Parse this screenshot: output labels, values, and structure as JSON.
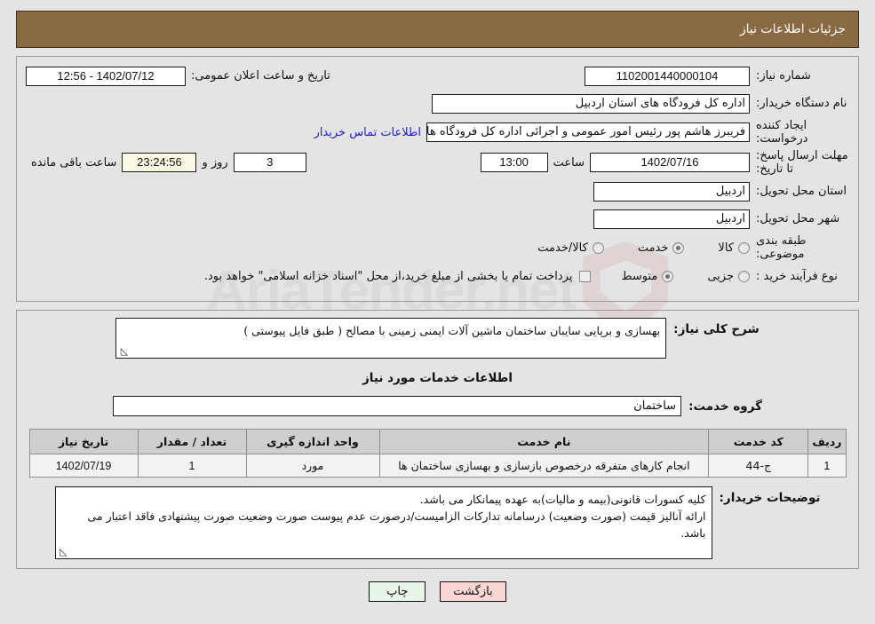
{
  "header": {
    "title": "جزئیات اطلاعات نیاز"
  },
  "form": {
    "need_number_label": "شماره نیاز:",
    "need_number_value": "1102001440000104",
    "public_announce_label": "تاریخ و ساعت اعلان عمومی:",
    "public_announce_value": "12:56 - 1402/07/12",
    "buyer_org_label": "نام دستگاه خریدار:",
    "buyer_org_value": "اداره کل فرودگاه های استان اردبیل",
    "creator_label": "ایجاد کننده درخواست:",
    "creator_value": "فریبرز هاشم پور رئیس امور عمومی و اجرائی اداره کل فرودگاه های استان اردبیل",
    "contact_link": "اطلاعات تماس خریدار",
    "deadline_label": "مهلت ارسال پاسخ: تا تاریخ:",
    "deadline_date": "1402/07/16",
    "deadline_hour_label": "ساعت",
    "deadline_hour_value": "13:00",
    "days_value": "3",
    "days_label": "روز و",
    "countdown_value": "23:24:56",
    "countdown_label": "ساعت باقی مانده",
    "province_label": "استان محل تحویل:",
    "province_value": "اردبیل",
    "city_label": "شهر محل تحویل:",
    "city_value": "اردبیل",
    "category_label": "طبقه بندی موضوعی:",
    "category_options": [
      {
        "label": "کالا",
        "selected": false
      },
      {
        "label": "خدمت",
        "selected": true
      },
      {
        "label": "کالا/خدمت",
        "selected": false
      }
    ],
    "process_label": "نوع فرآیند خرید :",
    "process_options": [
      {
        "label": "جزیی",
        "selected": false
      },
      {
        "label": "متوسط",
        "selected": true
      }
    ],
    "treasury_checkbox_text": "پرداخت تمام یا بخشی از مبلغ خرید،از محل \"اسناد خزانه اسلامی\" خواهد بود.",
    "treasury_checked": false
  },
  "description": {
    "label": "شرح کلی نیاز:",
    "value": "بهسازی و برپایی سایبان ساختمان ماشین آلات ایمنی زمینی با مصالح ( طبق فایل پیوستی )"
  },
  "services": {
    "section_title": "اطلاعات خدمات مورد نیاز",
    "group_label": "گروه خدمت:",
    "group_value": "ساختمان",
    "table": {
      "columns": [
        "ردیف",
        "کد خدمت",
        "نام خدمت",
        "واحد اندازه گیری",
        "تعداد / مقدار",
        "تاریخ نیاز"
      ],
      "rows": [
        {
          "row": "1",
          "code": "ج-44",
          "name": "انجام کارهای متفرقه درخصوص بازسازی و بهسازی ساختمان ها",
          "unit": "مورد",
          "quantity": "1",
          "need_date": "1402/07/19"
        }
      ]
    }
  },
  "buyer_notes": {
    "label": "توضیحات خریدار:",
    "line1": "کلیه کسورات قانونی(بیمه و مالیات)به عهده پیمانکار می باشد.",
    "line2": "ارائه آنالیز قیمت (صورت وضعیت) درسامانه تدارکات الزامیست/درصورت عدم پیوست صورت وضعیت صورت پیشنهادی فاقد اعتبار می باشد."
  },
  "footer": {
    "print_label": "چاپ",
    "back_label": "بازگشت"
  },
  "watermark": {
    "text": "AriaTender.net"
  },
  "colors": {
    "header_bg": "#8a6a43",
    "page_bg": "#e4e4e4",
    "link": "#1f1fd0",
    "countdown_bg": "#fbf8e3",
    "table_header_bg": "#cfcfcf",
    "print_btn_bg": "#e6f5e6",
    "back_btn_bg": "#fbd4d4"
  }
}
